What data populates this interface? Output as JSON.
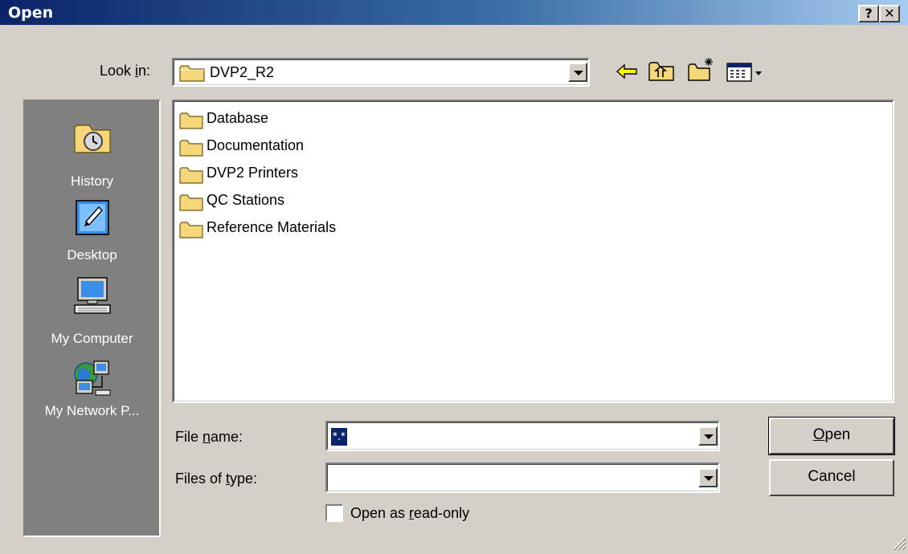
{
  "window": {
    "title": "Open",
    "help_label": "?",
    "close_label": "✕"
  },
  "lookin": {
    "label_prefix": "Look ",
    "label_accel": "i",
    "label_suffix": "n:",
    "value": "DVP2_R2"
  },
  "toolbar": {
    "back_icon": "back-arrow-icon",
    "up_icon": "up-one-level-icon",
    "newfolder_icon": "new-folder-icon",
    "views_icon": "view-menu-icon"
  },
  "places": [
    {
      "label": "History",
      "icon": "history-icon"
    },
    {
      "label": "Desktop",
      "icon": "desktop-icon"
    },
    {
      "label": "My Computer",
      "icon": "my-computer-icon"
    },
    {
      "label": "My Network P...",
      "icon": "network-places-icon"
    }
  ],
  "files": [
    {
      "name": "Database"
    },
    {
      "name": "Documentation"
    },
    {
      "name": "DVP2 Printers"
    },
    {
      "name": "QC Stations"
    },
    {
      "name": "Reference Materials"
    }
  ],
  "filename": {
    "label_prefix": "File ",
    "label_accel": "n",
    "label_suffix": "ame:",
    "value": "*.*"
  },
  "filetype": {
    "label_prefix": "Files of ",
    "label_accel": "t",
    "label_suffix": "ype:",
    "value": ""
  },
  "readonly": {
    "label_prefix": "Open as ",
    "label_accel": "r",
    "label_suffix": "ead-only",
    "checked": false
  },
  "buttons": {
    "open_accel": "O",
    "open_rest": "pen",
    "cancel": "Cancel"
  },
  "colors": {
    "title_start": "#0a246a",
    "title_end": "#a6caf0",
    "face": "#d4d0c8",
    "places_bg": "#808080",
    "selection": "#0a246a",
    "folder": "#f5d77a"
  }
}
